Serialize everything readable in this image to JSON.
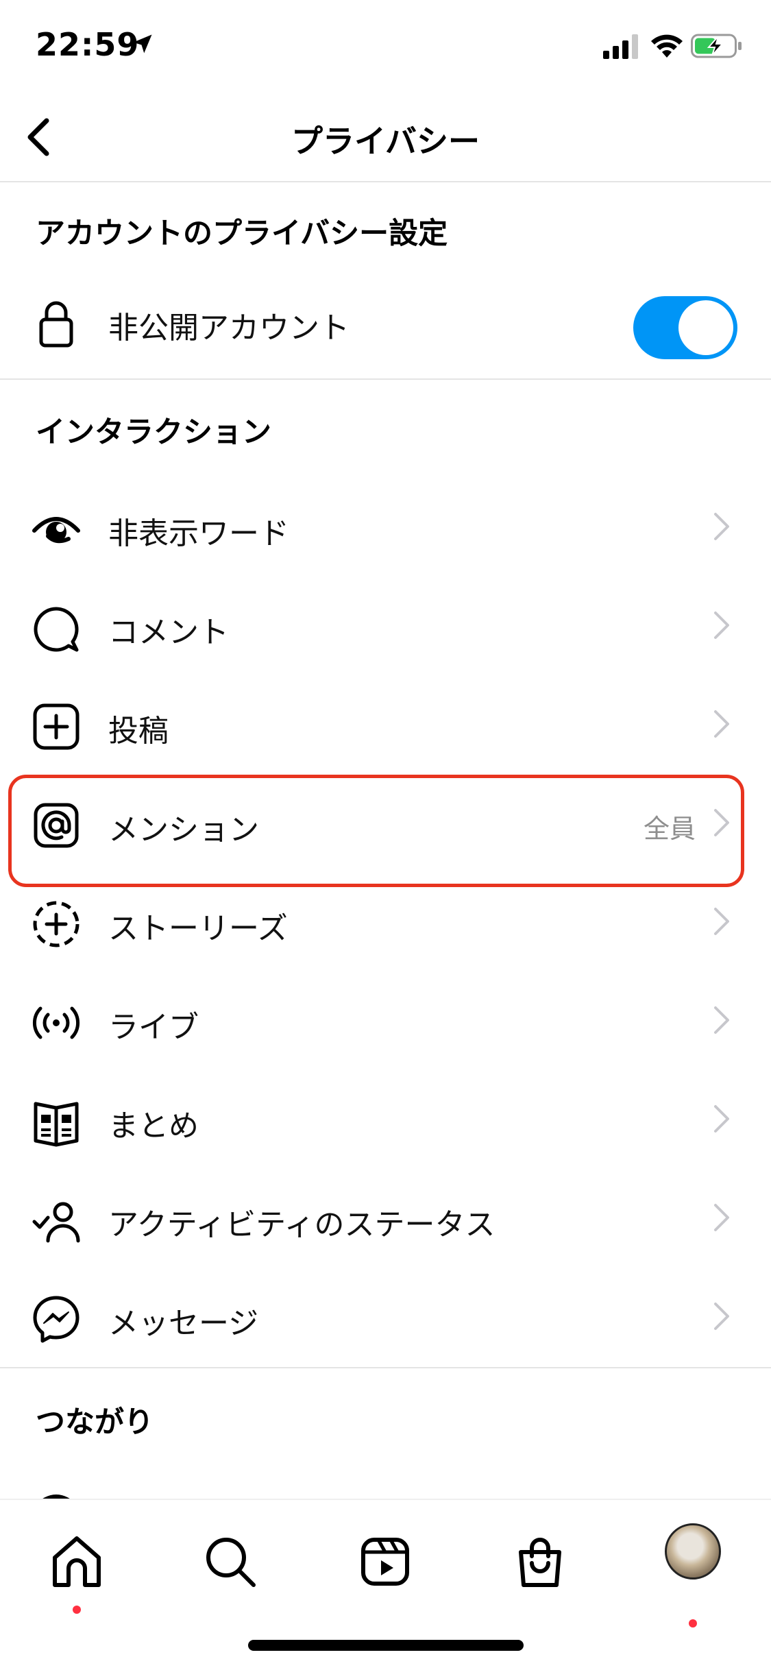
{
  "status_bar": {
    "time": "22:59",
    "icons": [
      "location-arrow-icon",
      "cellular-signal-icon",
      "wifi-icon",
      "battery-charging-icon"
    ]
  },
  "nav": {
    "title": "プライバシー",
    "back_icon": "chevron-left-icon"
  },
  "sections": {
    "account_privacy": {
      "header": "アカウントのプライバシー設定",
      "private_account": {
        "label": "非公開アカウント",
        "icon": "lock-icon",
        "toggle_on": true
      }
    },
    "interactions": {
      "header": "インタラクション",
      "items": [
        {
          "label": "非表示ワード",
          "icon": "hidden-words-icon",
          "value": ""
        },
        {
          "label": "コメント",
          "icon": "comment-icon",
          "value": ""
        },
        {
          "label": "投稿",
          "icon": "add-post-icon",
          "value": ""
        },
        {
          "label": "メンション",
          "icon": "mention-icon",
          "value": "全員"
        },
        {
          "label": "ストーリーズ",
          "icon": "add-story-icon",
          "value": ""
        },
        {
          "label": "ライブ",
          "icon": "live-icon",
          "value": ""
        },
        {
          "label": "まとめ",
          "icon": "guides-icon",
          "value": ""
        },
        {
          "label": "アクティビティのステータス",
          "icon": "activity-status-icon",
          "value": ""
        },
        {
          "label": "メッセージ",
          "icon": "messenger-icon",
          "value": ""
        }
      ]
    },
    "connections": {
      "header": "つながり"
    }
  },
  "tab_bar": {
    "tabs": [
      "home-icon",
      "search-icon",
      "reels-icon",
      "shop-icon",
      "profile-avatar"
    ]
  },
  "colors": {
    "accent": "#0095f6",
    "highlight": "#e8341f",
    "notification_dot": "#ff3040",
    "secondary_text": "#8e8e8e"
  }
}
